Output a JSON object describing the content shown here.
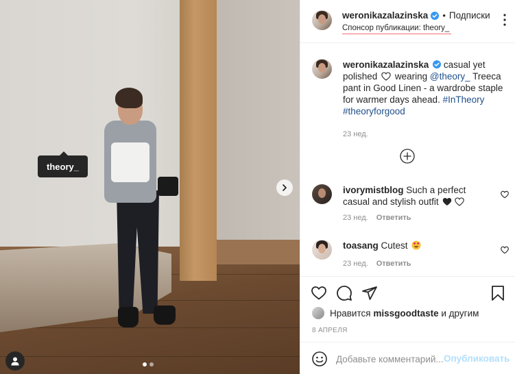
{
  "photo": {
    "tag_label": "theory_"
  },
  "header": {
    "username": "weronikazalazinska",
    "separator": "•",
    "follow_label": "Подписки",
    "sponsor_prefix": "Спонсор публикации: ",
    "sponsor_name": "theory_"
  },
  "caption": {
    "username": "weronikazalazinska",
    "text_part1": "casual yet polished",
    "text_part2": "wearing",
    "mention": "@theory_",
    "text_part3": "Treeca pant in Good Linen - a wardrobe staple for warmer days ahead.",
    "hashtag1": "#InTheory",
    "hashtag2": "#theoryforgood",
    "time": "23 нед."
  },
  "comments": [
    {
      "username": "ivorymistblog",
      "text": "Such a perfect casual and stylish outfit",
      "time": "23 нед.",
      "reply_label": "Ответить"
    },
    {
      "username": "toasang",
      "text": "Cutest",
      "time": "23 нед.",
      "reply_label": "Ответить"
    }
  ],
  "likes": {
    "prefix": "Нравится",
    "user": "missgoodtaste",
    "suffix": "и другим"
  },
  "post_date": "8 апреля",
  "add_comment": {
    "placeholder": "Добавьте комментарий...",
    "publish_label": "Опубликовать"
  },
  "colors": {
    "link": "#1f4f8a",
    "verified": "#3897f0",
    "publish_disabled": "#b2dffc",
    "meta_gray": "#8e8e8e"
  },
  "icons": {
    "heart": "heart-icon",
    "comment": "comment-icon",
    "share": "paper-plane-icon",
    "save": "bookmark-icon",
    "emoji": "smiley-icon",
    "more": "ellipsis-icon",
    "next": "chevron-right-icon",
    "user_tags": "user-icon",
    "load_more": "plus-circle-icon"
  }
}
